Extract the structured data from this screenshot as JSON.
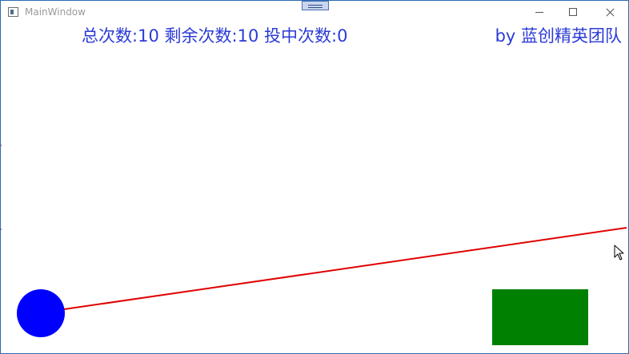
{
  "window": {
    "title": "MainWindow"
  },
  "hud": {
    "total_label": "总次数:",
    "total_value": "10",
    "remaining_label": "剩余次数:",
    "remaining_value": "10",
    "hits_label": "投中次数:",
    "hits_value": "0",
    "credit": "by 蓝创精英团队"
  },
  "scene": {
    "ball_color": "#0000ff",
    "aim_line_color": "#e00000",
    "target_color": "#008000",
    "title_color": "#2b3bd6"
  },
  "icons": {
    "app": "app-window-icon",
    "minimize": "minimize-icon",
    "maximize": "maximize-icon",
    "close": "close-icon",
    "cursor": "mouse-cursor-icon",
    "grip": "drag-grip-icon"
  }
}
